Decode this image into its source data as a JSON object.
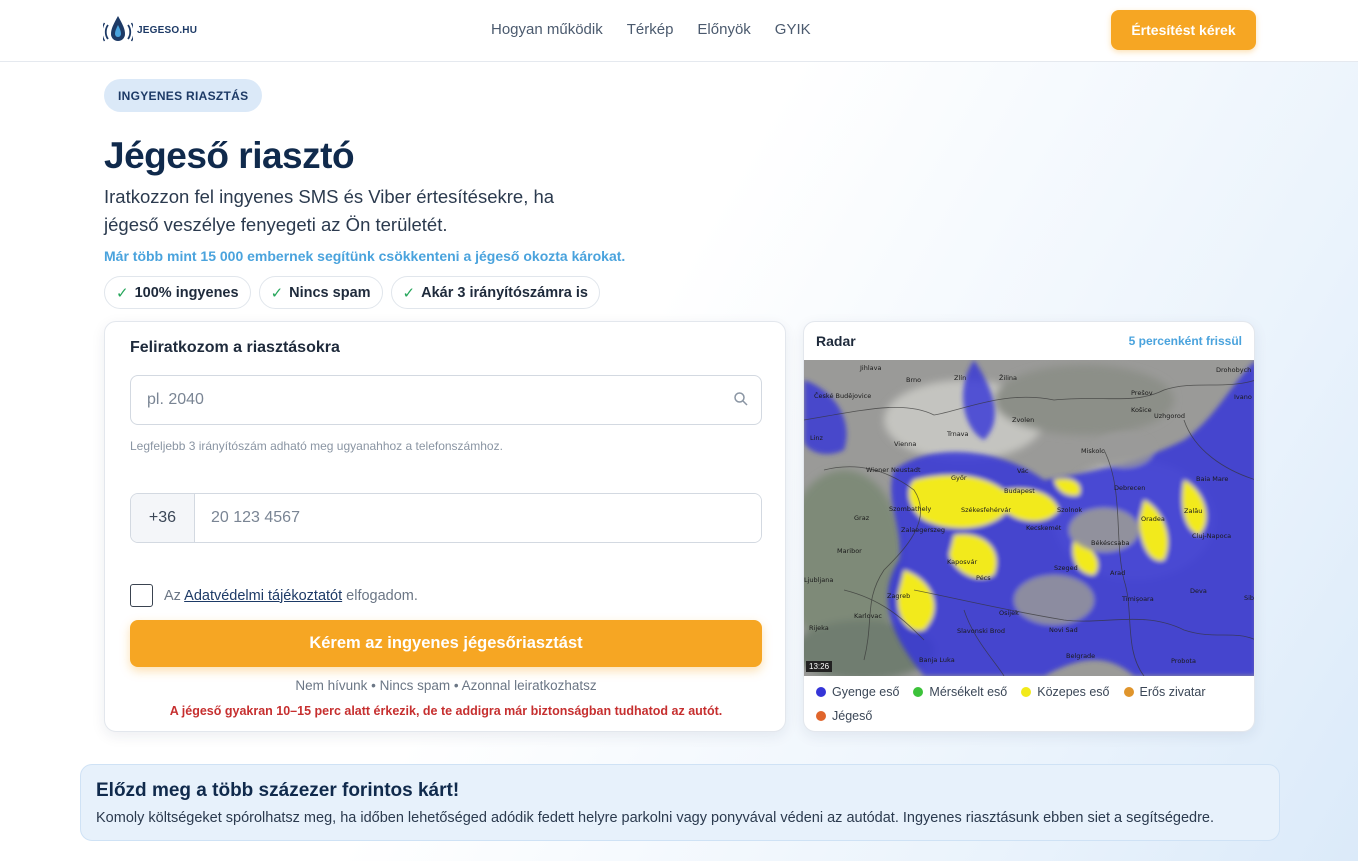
{
  "header": {
    "logo_text": "JEGESO.HU",
    "nav": [
      "Hogyan működik",
      "Térkép",
      "Előnyök",
      "GYIK"
    ],
    "cta_label": "Értesítést kérek"
  },
  "hero": {
    "pill": "INGYENES RIASZTÁS",
    "title": "Jégeső riasztó",
    "subtitle": "Iratkozzon fel ingyenes SMS és Viber értesítésekre, ha jégeső veszélye fenyegeti az Ön területét.",
    "highlight": "Már több mint 15 000 embernek segítünk csökkenteni a jégeső okozta károkat.",
    "badges": [
      "100% ingyenes",
      "Nincs spam",
      "Akár 3 irányítószámra is"
    ]
  },
  "form": {
    "title": "Feliratkozom a riasztásokra",
    "zip_placeholder": "pl. 2040",
    "zip_value": "",
    "hint": "Legfeljebb 3 irányítószám adható meg ugyanahhoz a telefonszámhoz.",
    "phone_prefix": "+36",
    "phone_placeholder": "20 123 4567",
    "phone_value": "",
    "consent_prefix": "Az",
    "consent_link": "Adatvédelmi tájékoztatót",
    "consent_suffix": "elfogadom.",
    "consent_checked": false,
    "submit_label": "Kérem az ingyenes jégesőriasztást",
    "assurance": "Nem hívunk • Nincs spam • Azonnal leiratkozhatsz",
    "warning": "A jégeső gyakran 10–15 perc alatt érkezik, de te addigra már biztonságban tudhatod az autót."
  },
  "radar": {
    "title": "Radar",
    "refresh_note": "5 percenként frissül",
    "timestamp": "13:26",
    "cities": [
      "Jihlava",
      "Brno",
      "Zlín",
      "Žilina",
      "Prešov",
      "Košice",
      "Uzhgorod",
      "Drohobych",
      "Ivano",
      "České Budějovice",
      "Linz",
      "Vienna",
      "Trnava",
      "Zvolen",
      "Miskolc",
      "Wiener Neustadt",
      "Győr",
      "Vác",
      "Budapest",
      "Debrecen",
      "Baia Mare",
      "Szombathely",
      "Székesfehérvár",
      "Szolnok",
      "Oradea",
      "Zalău",
      "Graz",
      "Zalaegerszeg",
      "Kecskemét",
      "Békéscsaba",
      "Cluj-Napoca",
      "Maribor",
      "Kaposvár",
      "Szeged",
      "Arad",
      "Ljubljana",
      "Pécs",
      "Timișoara",
      "Deva",
      "Zagreb",
      "Osijek",
      "Karlovac",
      "Novi Sad",
      "Rijeka",
      "Slavonski Brod",
      "Belgrade",
      "Banja Luka",
      "Probota",
      "Sibiu"
    ],
    "legend": [
      {
        "label": "Gyenge eső",
        "color": "#3535d8"
      },
      {
        "label": "Mérsékelt eső",
        "color": "#3cc23a"
      },
      {
        "label": "Közepes eső",
        "color": "#f2ea1a"
      },
      {
        "label": "Erős zivatar",
        "color": "#e0952c"
      },
      {
        "label": "Jégeső",
        "color": "#e0652c"
      }
    ]
  },
  "banner": {
    "title": "Előzd meg a több százezer forintos kárt!",
    "text": "Komoly költségeket spórolhatsz meg, ha időben lehetőséged adódik fedett helyre parkolni vagy ponyvával védeni az autódat. Ingyenes riasztásunk ebben siet a segítségedre."
  }
}
